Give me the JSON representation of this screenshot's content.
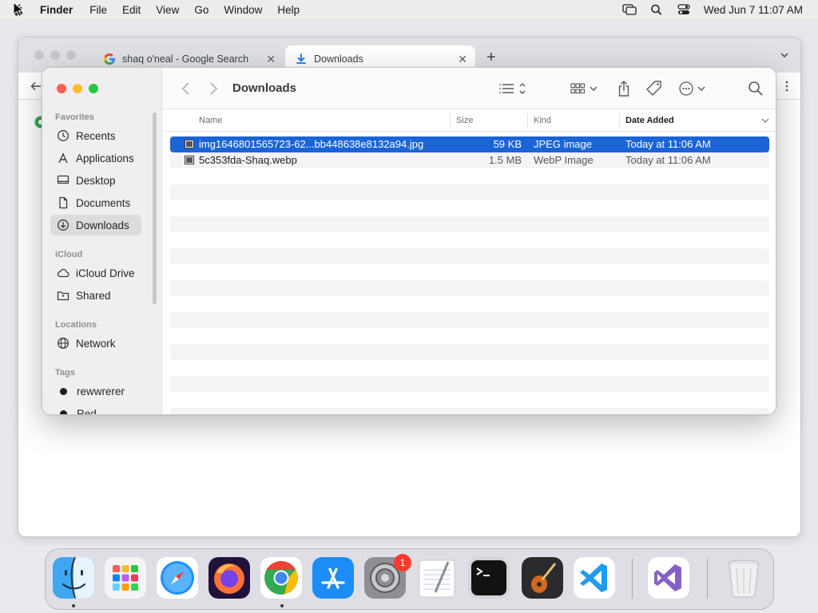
{
  "menubar": {
    "app_name": "Finder",
    "menus": [
      "File",
      "Edit",
      "View",
      "Go",
      "Window",
      "Help"
    ],
    "clock": "Wed Jun 7  11:07 AM",
    "icons": [
      "screen-mirroring-icon",
      "spotlight-search-icon",
      "control-center-icon"
    ]
  },
  "chrome": {
    "tabs": [
      {
        "label": "shaq o'neal - Google Search",
        "icon": "google-icon"
      },
      {
        "label": "Downloads",
        "icon": "download-icon"
      }
    ]
  },
  "finder": {
    "title": "Downloads",
    "sidebar": {
      "favorites_label": "Favorites",
      "favorites": [
        {
          "label": "Recents",
          "icon": "clock-icon"
        },
        {
          "label": "Applications",
          "icon": "applications-icon"
        },
        {
          "label": "Desktop",
          "icon": "desktop-icon"
        },
        {
          "label": "Documents",
          "icon": "document-icon"
        },
        {
          "label": "Downloads",
          "icon": "download-circle-icon",
          "selected": true
        }
      ],
      "icloud_label": "iCloud",
      "icloud": [
        {
          "label": "iCloud Drive",
          "icon": "cloud-icon"
        },
        {
          "label": "Shared",
          "icon": "shared-folder-icon"
        }
      ],
      "locations_label": "Locations",
      "locations": [
        {
          "label": "Network",
          "icon": "globe-icon"
        }
      ],
      "tags_label": "Tags",
      "tags": [
        {
          "label": "rewwrerer",
          "color": "#1d1d1f"
        },
        {
          "label": "Red",
          "color": "#1d1d1f"
        }
      ]
    },
    "columns": {
      "name": "Name",
      "size": "Size",
      "kind": "Kind",
      "date": "Date Added"
    },
    "files": [
      {
        "name": "img1646801565723-62...bb448638e8132a94.jpg",
        "size": "59 KB",
        "kind": "JPEG image",
        "date": "Today at 11:06 AM",
        "selected": true
      },
      {
        "name": "5c353fda-Shaq.webp",
        "size": "1.5 MB",
        "kind": "WebP Image",
        "date": "Today at 11:06 AM",
        "selected": false
      }
    ]
  },
  "dock": {
    "apps": [
      "Finder",
      "Launchpad",
      "Safari",
      "Firefox",
      "Google Chrome",
      "App Store",
      "System Settings",
      "TextEdit",
      "Terminal",
      "GarageBand",
      "Visual Studio Code",
      "Visual Studio",
      "Trash"
    ],
    "system_settings_badge": "1"
  },
  "colors": {
    "selection": "#1a64d6",
    "traffic_red": "#fe5f57",
    "traffic_yellow": "#febc2e",
    "traffic_green": "#28c840"
  }
}
